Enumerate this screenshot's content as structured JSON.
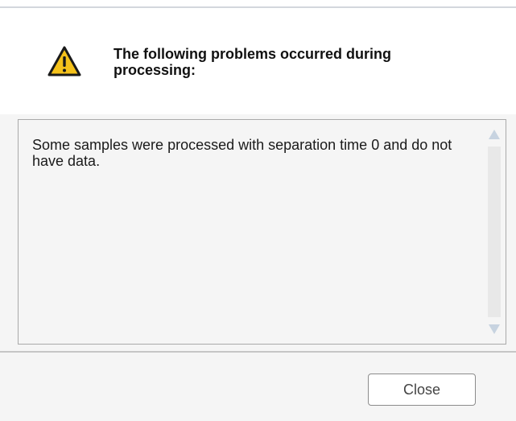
{
  "dialog": {
    "icon": "warning-icon",
    "header_text": "The following problems occurred during processing:",
    "message": "Some samples were processed with separation time 0 and do not have data.",
    "close_label": "Close"
  },
  "colors": {
    "warning_yellow": "#f5c21b",
    "warning_outline": "#1a1a1a",
    "content_background": "#f5f5f5",
    "scrollbar_track": "#e8e8e8",
    "scrollbar_arrow": "#c7d3e0"
  }
}
